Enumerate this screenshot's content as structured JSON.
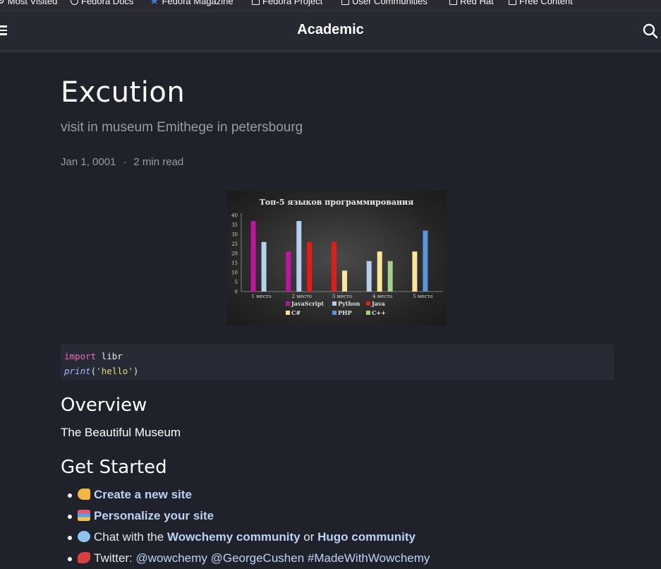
{
  "bookmarks": [
    {
      "label": "Most Visited",
      "icon": "gear-icon"
    },
    {
      "label": "Fedora Docs",
      "icon": "globe-icon"
    },
    {
      "label": "Fedora Magazine",
      "icon": "star-icon"
    },
    {
      "label": "Fedora Project",
      "icon": "folder-icon"
    },
    {
      "label": "User Communities",
      "icon": "folder-icon"
    },
    {
      "label": "Red Hat",
      "icon": "folder-icon"
    },
    {
      "label": "Free Content",
      "icon": "folder-icon"
    }
  ],
  "navbar": {
    "brand": "Academic",
    "menu_icon": "hamburger-icon",
    "search_icon": "search-icon"
  },
  "article": {
    "title": "Excution",
    "subtitle": "visit in museum Emithege in petersbourg",
    "date": "Jan 1, 0001",
    "separator": "·",
    "read_time": "2 min read"
  },
  "chart_data": {
    "type": "bar",
    "title": "Топ-5 языков программирования",
    "categories": [
      "1 место",
      "2 место",
      "3 место",
      "4 место",
      "5 место"
    ],
    "ylim": [
      0,
      40
    ],
    "yticks": [
      0,
      5,
      10,
      15,
      20,
      25,
      30,
      35,
      40
    ],
    "legend_position": "bottom",
    "series": [
      {
        "name": "JavaScript",
        "color": "#c0149f",
        "values": [
          37,
          21,
          null,
          null,
          null
        ]
      },
      {
        "name": "Python",
        "color": "#b8cfee",
        "values": [
          26,
          37,
          null,
          16,
          null
        ]
      },
      {
        "name": "Java",
        "color": "#e41b17",
        "values": [
          null,
          26,
          26,
          null,
          null
        ]
      },
      {
        "name": "C#",
        "color": "#fbe59a",
        "values": [
          null,
          null,
          11,
          21,
          21
        ]
      },
      {
        "name": "PHP",
        "color": "#5b97d8",
        "values": [
          null,
          null,
          null,
          null,
          32
        ]
      },
      {
        "name": "C++",
        "color": "#a4d08c",
        "values": [
          null,
          null,
          null,
          16,
          null
        ]
      }
    ]
  },
  "code": {
    "line1": {
      "keyword": "import",
      "rest": " libr"
    },
    "line2": {
      "func": "print",
      "open": "(",
      "string": "'hello'",
      "close": ")"
    }
  },
  "overview": {
    "heading": "Overview",
    "text": "The Beautiful Museum"
  },
  "get_started": {
    "heading": "Get Started",
    "items": [
      {
        "emoji": "pointing-hand-icon",
        "link": "Create a new site"
      },
      {
        "emoji": "books-icon",
        "link": "Personalize your site"
      },
      {
        "emoji": "speech-bubble-icon",
        "prefix": "Chat with the ",
        "link": "Wowchemy community",
        "middle": " or ",
        "link2": "Hugo community"
      },
      {
        "emoji": "bird-icon",
        "prefix": "Twitter: ",
        "links": [
          "@wowchemy",
          "@GeorgeCushen",
          "#MadeWithWowchemy"
        ]
      }
    ]
  }
}
